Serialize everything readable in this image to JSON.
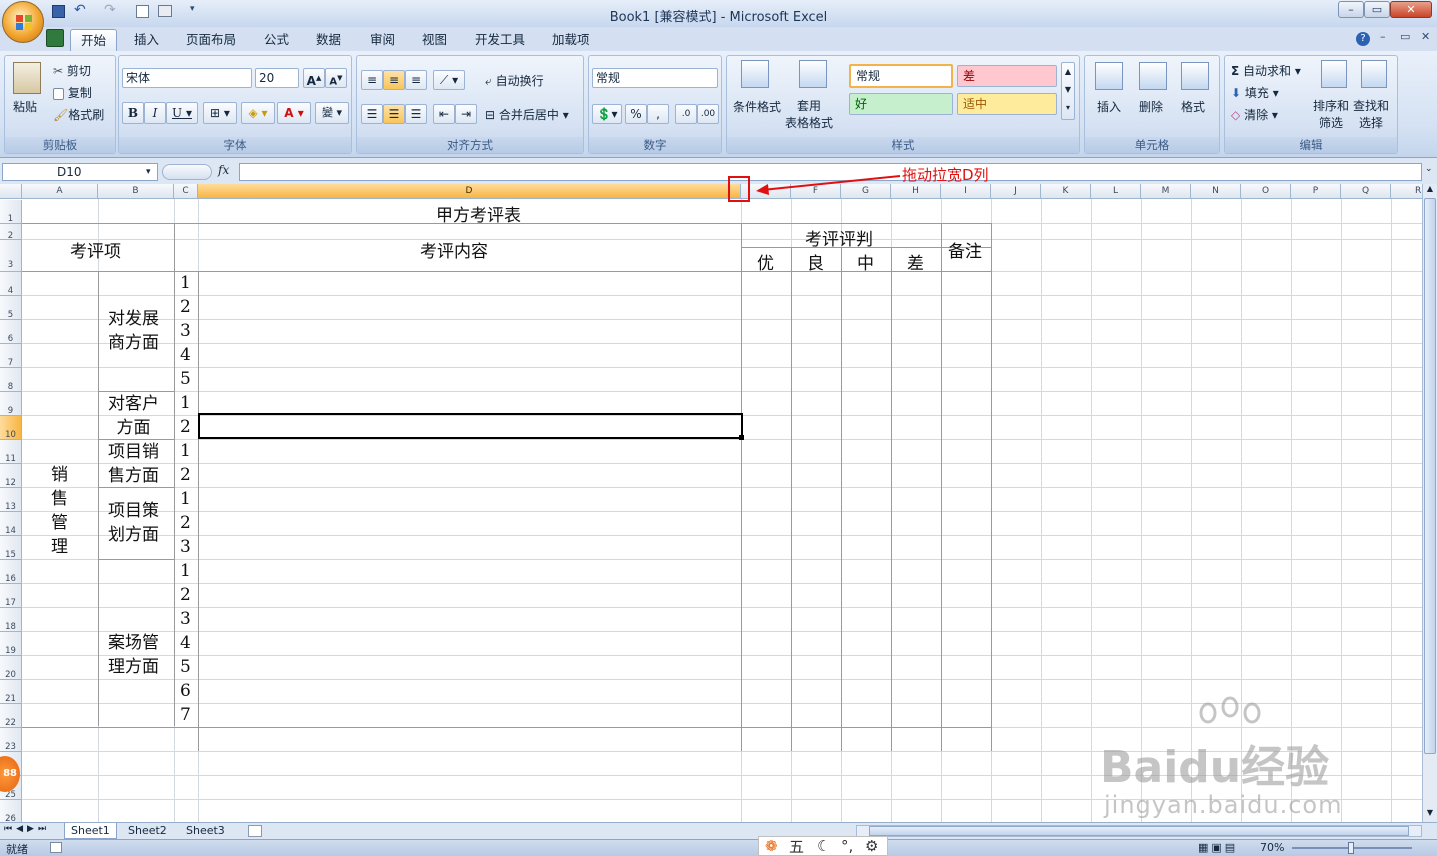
{
  "window": {
    "title": "Book1  [兼容模式] - Microsoft Excel",
    "controls": [
      "–",
      "▭",
      "✕"
    ]
  },
  "tabs": [
    "开始",
    "插入",
    "页面布局",
    "公式",
    "数据",
    "审阅",
    "视图",
    "开发工具",
    "加载项"
  ],
  "active_tab": "开始",
  "ribbon": {
    "clipboard": {
      "label": "剪贴板",
      "paste": "粘贴",
      "cut": "剪切",
      "copy": "复制",
      "format_painter": "格式刷"
    },
    "font": {
      "label": "字体",
      "name": "宋体",
      "size": "20"
    },
    "alignment": {
      "label": "对齐方式",
      "wrap": "自动换行",
      "merge": "合并后居中"
    },
    "number": {
      "label": "数字",
      "format": "常规"
    },
    "styles": {
      "label": "样式",
      "conditional": "条件格式",
      "table": "套用\n表格格式",
      "normal": "常规",
      "bad": "差",
      "good": "好",
      "neutral": "适中"
    },
    "cells": {
      "label": "单元格",
      "insert": "插入",
      "delete": "删除",
      "format": "格式"
    },
    "editing": {
      "label": "编辑",
      "autosum": "自动求和",
      "fill": "填充",
      "clear": "清除",
      "sort": "排序和\n筛选",
      "find": "查找和\n选择"
    }
  },
  "formula_bar": {
    "name_box": "D10",
    "fx": "fx",
    "formula": ""
  },
  "columns": [
    "A",
    "B",
    "C",
    "D",
    "E",
    "F",
    "G",
    "H",
    "I",
    "J",
    "K",
    "L",
    "M",
    "N",
    "O",
    "P",
    "Q",
    "R"
  ],
  "rows": [
    "1",
    "2",
    "3",
    "4",
    "5",
    "6",
    "7",
    "8",
    "9",
    "10",
    "11",
    "12",
    "13",
    "14",
    "15",
    "16",
    "17",
    "18",
    "19",
    "20",
    "21",
    "22",
    "23",
    "24",
    "25",
    "26"
  ],
  "sheet": {
    "title": "甲方考评表",
    "h_item": "考评项",
    "h_content": "考评内容",
    "h_judge": "考评评判",
    "h_note": "备注",
    "grades": [
      "优",
      "良",
      "中",
      "差"
    ],
    "category": "销\n售\n管\n理",
    "groups": [
      {
        "name": "对发展\n商方面",
        "nums": [
          "1",
          "2",
          "3",
          "4",
          "5"
        ]
      },
      {
        "name": "对客户\n方面",
        "nums": [
          "1",
          "2"
        ]
      },
      {
        "name": "项目销\n售方面",
        "nums": [
          "1",
          "2"
        ]
      },
      {
        "name": "项目策\n划方面",
        "nums": [
          "1",
          "2",
          "3"
        ]
      },
      {
        "name": "案场管\n理方面",
        "nums": [
          "1",
          "2",
          "3",
          "4",
          "5",
          "6",
          "7"
        ]
      }
    ]
  },
  "annotation": "拖动拉宽D列",
  "sheet_tabs": [
    "Sheet1",
    "Sheet2",
    "Sheet3"
  ],
  "status": {
    "ready": "就绪",
    "zoom": "70%"
  },
  "ime": {
    "mode": "五"
  },
  "watermark": {
    "brand": "Baidu经验",
    "url": "jingyan.baidu.com"
  },
  "badge": "88"
}
